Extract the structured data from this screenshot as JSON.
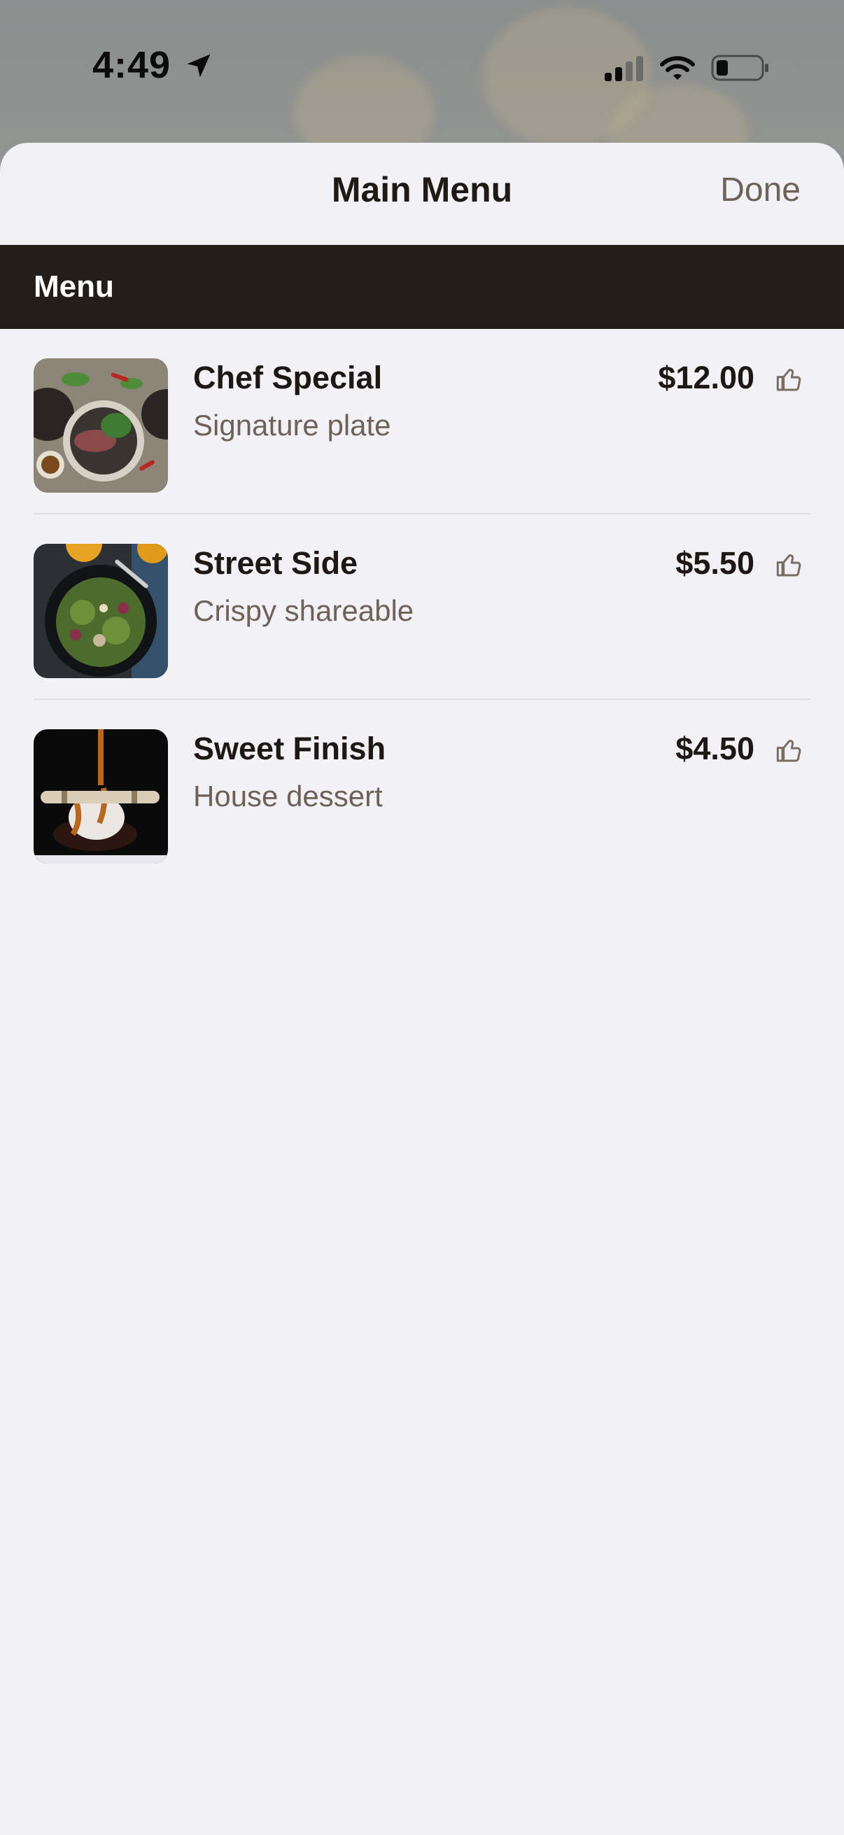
{
  "status_bar": {
    "time": "4:49",
    "icons": [
      "location-arrow-icon",
      "cellular-signal-icon",
      "wifi-icon",
      "battery-icon"
    ]
  },
  "sheet": {
    "title": "Main Menu",
    "done_label": "Done"
  },
  "section": {
    "title": "Menu"
  },
  "items": [
    {
      "name": "Chef Special",
      "description": "Signature plate",
      "price": "$12.00",
      "image": "steak-salad-plate",
      "icon": "thumbs-up-icon"
    },
    {
      "name": "Street Side",
      "description": "Crispy shareable",
      "price": "$5.50",
      "image": "green-salad-bowl",
      "icon": "thumbs-up-icon"
    },
    {
      "name": "Sweet Finish",
      "description": "House dessert",
      "price": "$4.50",
      "image": "caramel-ice-cream-dessert",
      "icon": "thumbs-up-icon"
    }
  ],
  "colors": {
    "section_bg": "#221d19",
    "text_primary": "#1d1814",
    "text_secondary": "#6e6258",
    "sheet_bg": "#f1f1f6"
  }
}
